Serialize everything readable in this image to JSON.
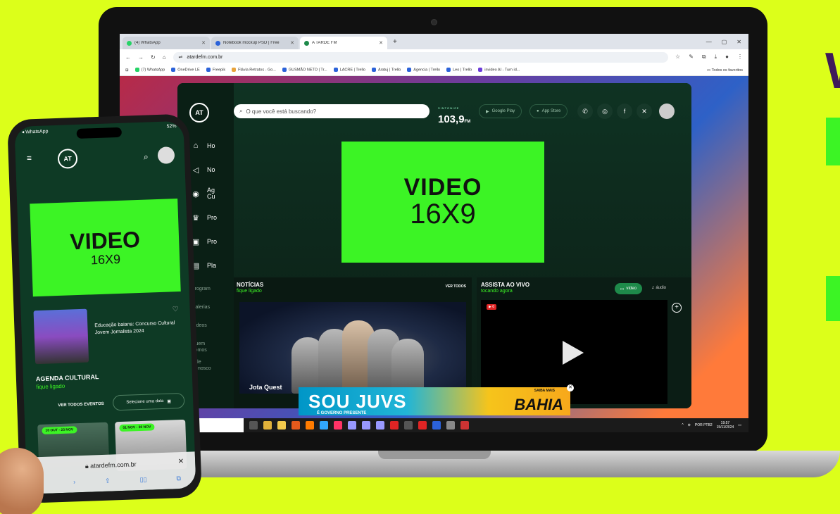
{
  "browser": {
    "tabs": [
      {
        "label": "(4) WhatsApp",
        "active": false
      },
      {
        "label": "Notebook mockup PSD | Free",
        "active": false
      },
      {
        "label": "A TARDE FM",
        "active": true
      }
    ],
    "new_tab": "+",
    "url": "atardefm.com.br",
    "bookmarks": [
      "(7) WhatsApp",
      "OneDrive LE",
      "Freepik",
      "Flávia Retratos - Go...",
      "GUSMÃO NETO | Tr...",
      "LACRE | Trello",
      "Aratuj | Trello",
      "Agencia | Trello",
      "Leo | Trello",
      "invideo AI - Turn id..."
    ],
    "bookmarks_right": "Todos os favoritos"
  },
  "site": {
    "logo": "AT",
    "search_placeholder": "O que você está buscando?",
    "radio_label": "SINTONIZE",
    "radio_freq": "103,9",
    "radio_unit": "FM",
    "google_play": "Google Play",
    "app_store": "App Store",
    "social_icons": [
      "whatsapp-icon",
      "instagram-icon",
      "facebook-icon",
      "x-icon"
    ],
    "side_menu": [
      {
        "icon": "home-icon",
        "label": "Ho"
      },
      {
        "icon": "megaphone-icon",
        "label": "No"
      },
      {
        "icon": "location-icon",
        "label": "Ag\nCu"
      },
      {
        "icon": "trophy-icon",
        "label": "Pro"
      },
      {
        "icon": "gift-icon",
        "label": "Pro"
      },
      {
        "icon": "playlist-icon",
        "label": "Pla"
      }
    ],
    "side_links": [
      "Program",
      "Galerias",
      "Vídeos",
      "Quem Somos",
      "Fale Conosco"
    ],
    "hero_title": "VIDEO",
    "hero_ratio": "16X9",
    "news": {
      "title": "NOTÍCIAS",
      "subtitle": "fique ligado",
      "see_all": "VER TODOS",
      "caption": "Jota Quest"
    },
    "live": {
      "title": "ASSISTA AO VIVO",
      "subtitle": "tocando agora",
      "video_toggle": "vídeo",
      "audio_toggle": "áudio",
      "badge": "▶ 6"
    },
    "banner": {
      "main": "SOU JUVS",
      "sub": "É GOVERNO PRESENTE",
      "right": "BAHIA",
      "cta": "SAIBA MAIS"
    }
  },
  "taskbar": {
    "lang": "POR PTB2",
    "time": "19:57",
    "date": "15/11/2024"
  },
  "phone": {
    "carrier": "◂ WhatsApp",
    "battery": "52%",
    "logo": "AT",
    "hero_title": "VIDEO",
    "hero_ratio": "16X9",
    "card_text": "Educação baiana: Concurso Cultural Jovem Jornalista 2024",
    "agenda_title": "AGENDA CULTURAL",
    "agenda_sub": "fique ligado",
    "see_all": "VER TODOS EVENTOS",
    "date_select": "Selecione uma data",
    "events": [
      "10 OUT - 23 NOV",
      "01 NOV - 30 NOV"
    ],
    "url": "atardefm.com.br",
    "aa": "AA"
  },
  "colors": {
    "background": "#dcff1a",
    "accent_green": "#3cf425",
    "site_dark": "#0d2a1d"
  }
}
